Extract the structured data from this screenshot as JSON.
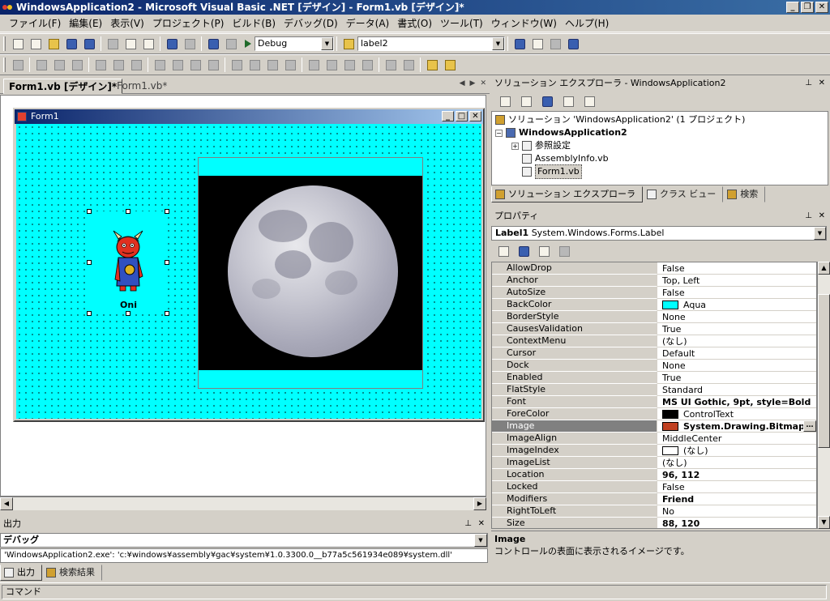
{
  "window": {
    "title": "WindowsApplication2 - Microsoft Visual Basic .NET [デザイン] - Form1.vb [デザイン]*"
  },
  "menu": [
    "ファイル(F)",
    "編集(E)",
    "表示(V)",
    "プロジェクト(P)",
    "ビルド(B)",
    "デバッグ(D)",
    "データ(A)",
    "書式(O)",
    "ツール(T)",
    "ウィンドウ(W)",
    "ヘルプ(H)"
  ],
  "toolbar": {
    "config": "Debug",
    "find": "label2"
  },
  "doc_tabs": {
    "active": "Form1.vb [デザイン]*",
    "inactive": "Form1.vb*"
  },
  "form": {
    "title": "Form1",
    "label_text": "Oni"
  },
  "solution_explorer": {
    "title": "ソリューション エクスプローラ - WindowsApplication2",
    "items": [
      "ソリューション 'WindowsApplication2' (1 プロジェクト)",
      "WindowsApplication2",
      "参照設定",
      "AssemblyInfo.vb",
      "Form1.vb"
    ],
    "tabs": [
      "ソリューション エクスプローラ",
      "クラス ビュー",
      "検索"
    ]
  },
  "properties": {
    "title": "プロパティ",
    "object": "Label1",
    "object_type": "System.Windows.Forms.Label",
    "rows": [
      {
        "name": "AllowDrop",
        "value": "False"
      },
      {
        "name": "Anchor",
        "value": "Top, Left"
      },
      {
        "name": "AutoSize",
        "value": "False"
      },
      {
        "name": "BackColor",
        "value": "Aqua"
      },
      {
        "name": "BorderStyle",
        "value": "None"
      },
      {
        "name": "CausesValidation",
        "value": "True"
      },
      {
        "name": "ContextMenu",
        "value": "(なし)"
      },
      {
        "name": "Cursor",
        "value": "Default"
      },
      {
        "name": "Dock",
        "value": "None"
      },
      {
        "name": "Enabled",
        "value": "True"
      },
      {
        "name": "FlatStyle",
        "value": "Standard"
      },
      {
        "name": "Font",
        "value": "MS UI Gothic, 9pt, style=Bold"
      },
      {
        "name": "ForeColor",
        "value": "ControlText"
      },
      {
        "name": "Image",
        "value": "System.Drawing.Bitmap"
      },
      {
        "name": "ImageAlign",
        "value": "MiddleCenter"
      },
      {
        "name": "ImageIndex",
        "value": "(なし)"
      },
      {
        "name": "ImageList",
        "value": "(なし)"
      },
      {
        "name": "Location",
        "value": "96, 112"
      },
      {
        "name": "Locked",
        "value": "False"
      },
      {
        "name": "Modifiers",
        "value": "Friend"
      },
      {
        "name": "RightToLeft",
        "value": "No"
      },
      {
        "name": "Size",
        "value": "88, 120"
      }
    ],
    "description_title": "Image",
    "description_text": "コントロールの表面に表示されるイメージです。"
  },
  "output": {
    "title": "出力",
    "pane": "デバッグ",
    "text": "'WindowsApplication2.exe': 'c:¥windows¥assembly¥gac¥system¥1.0.3300.0__b77a5c561934e089¥system.dll'",
    "tabs": [
      "出力",
      "検索結果"
    ]
  },
  "status": {
    "text": "コマンド"
  },
  "colors": {
    "aqua": "#00ffff",
    "titlebar": "#0a246a",
    "black": "#000000"
  }
}
